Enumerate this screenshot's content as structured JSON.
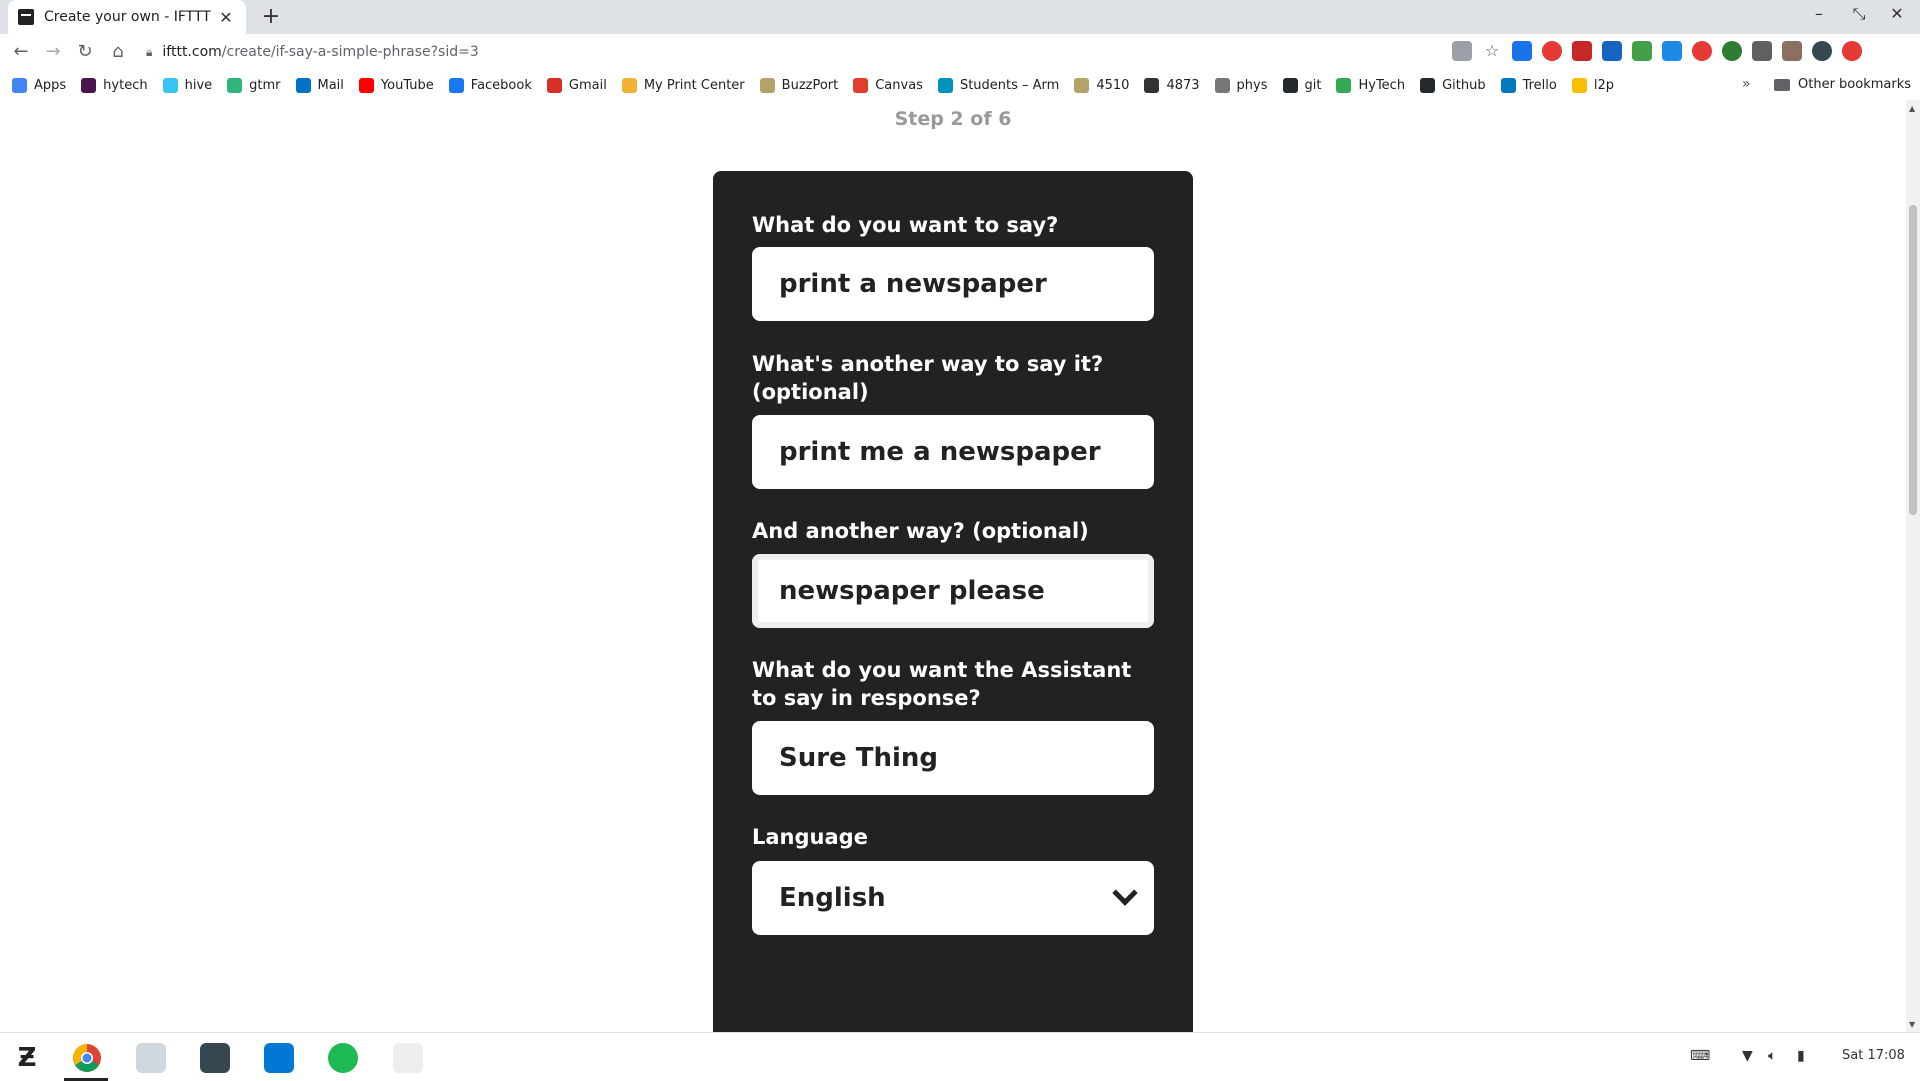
{
  "browser": {
    "tab_title": "Create your own - IFTTT",
    "tab_close": "✕",
    "new_tab": "+",
    "url_domain": "ifttt.com",
    "url_path": "/create/if-say-a-simple-phrase?sid=3"
  },
  "bookmarks": [
    {
      "label": "Apps",
      "color": "#4285f4"
    },
    {
      "label": "hytech",
      "color": "#4a154b"
    },
    {
      "label": "hive",
      "color": "#36c5f0"
    },
    {
      "label": "gtmr",
      "color": "#2eb67d"
    },
    {
      "label": "Mail",
      "color": "#0072c6"
    },
    {
      "label": "YouTube",
      "color": "#ff0000"
    },
    {
      "label": "Facebook",
      "color": "#1877f2"
    },
    {
      "label": "Gmail",
      "color": "#d93025"
    },
    {
      "label": "My Print Center",
      "color": "#f2b233"
    },
    {
      "label": "BuzzPort",
      "color": "#b3a369"
    },
    {
      "label": "Canvas",
      "color": "#e13f2b"
    },
    {
      "label": "Students – Arm",
      "color": "#0091bd"
    },
    {
      "label": "4510",
      "color": "#b3a369"
    },
    {
      "label": "4873",
      "color": "#333333"
    },
    {
      "label": "phys",
      "color": "#777777"
    },
    {
      "label": "git",
      "color": "#24292e"
    },
    {
      "label": "HyTech",
      "color": "#34a853"
    },
    {
      "label": "Github",
      "color": "#24292e"
    },
    {
      "label": "Trello",
      "color": "#0079bf"
    },
    {
      "label": "l2p",
      "color": "#fbbc04"
    }
  ],
  "bookmarks_more": "»",
  "other_bookmarks": "Other bookmarks",
  "page": {
    "step": "Step 2 of 6",
    "q1_label": "What do you want to say?",
    "q1_value": "print a newspaper",
    "q2_label": "What's another way to say it? (optional)",
    "q2_value": "print me a newspaper",
    "q3_label": "And another way? (optional)",
    "q3_value": "newspaper please",
    "q4_label": "What do you want the Assistant to say in response?",
    "q4_value": "Sure Thing",
    "lang_label": "Language",
    "lang_value": "English"
  },
  "taskbar": {
    "clock": "Sat 17:08"
  }
}
